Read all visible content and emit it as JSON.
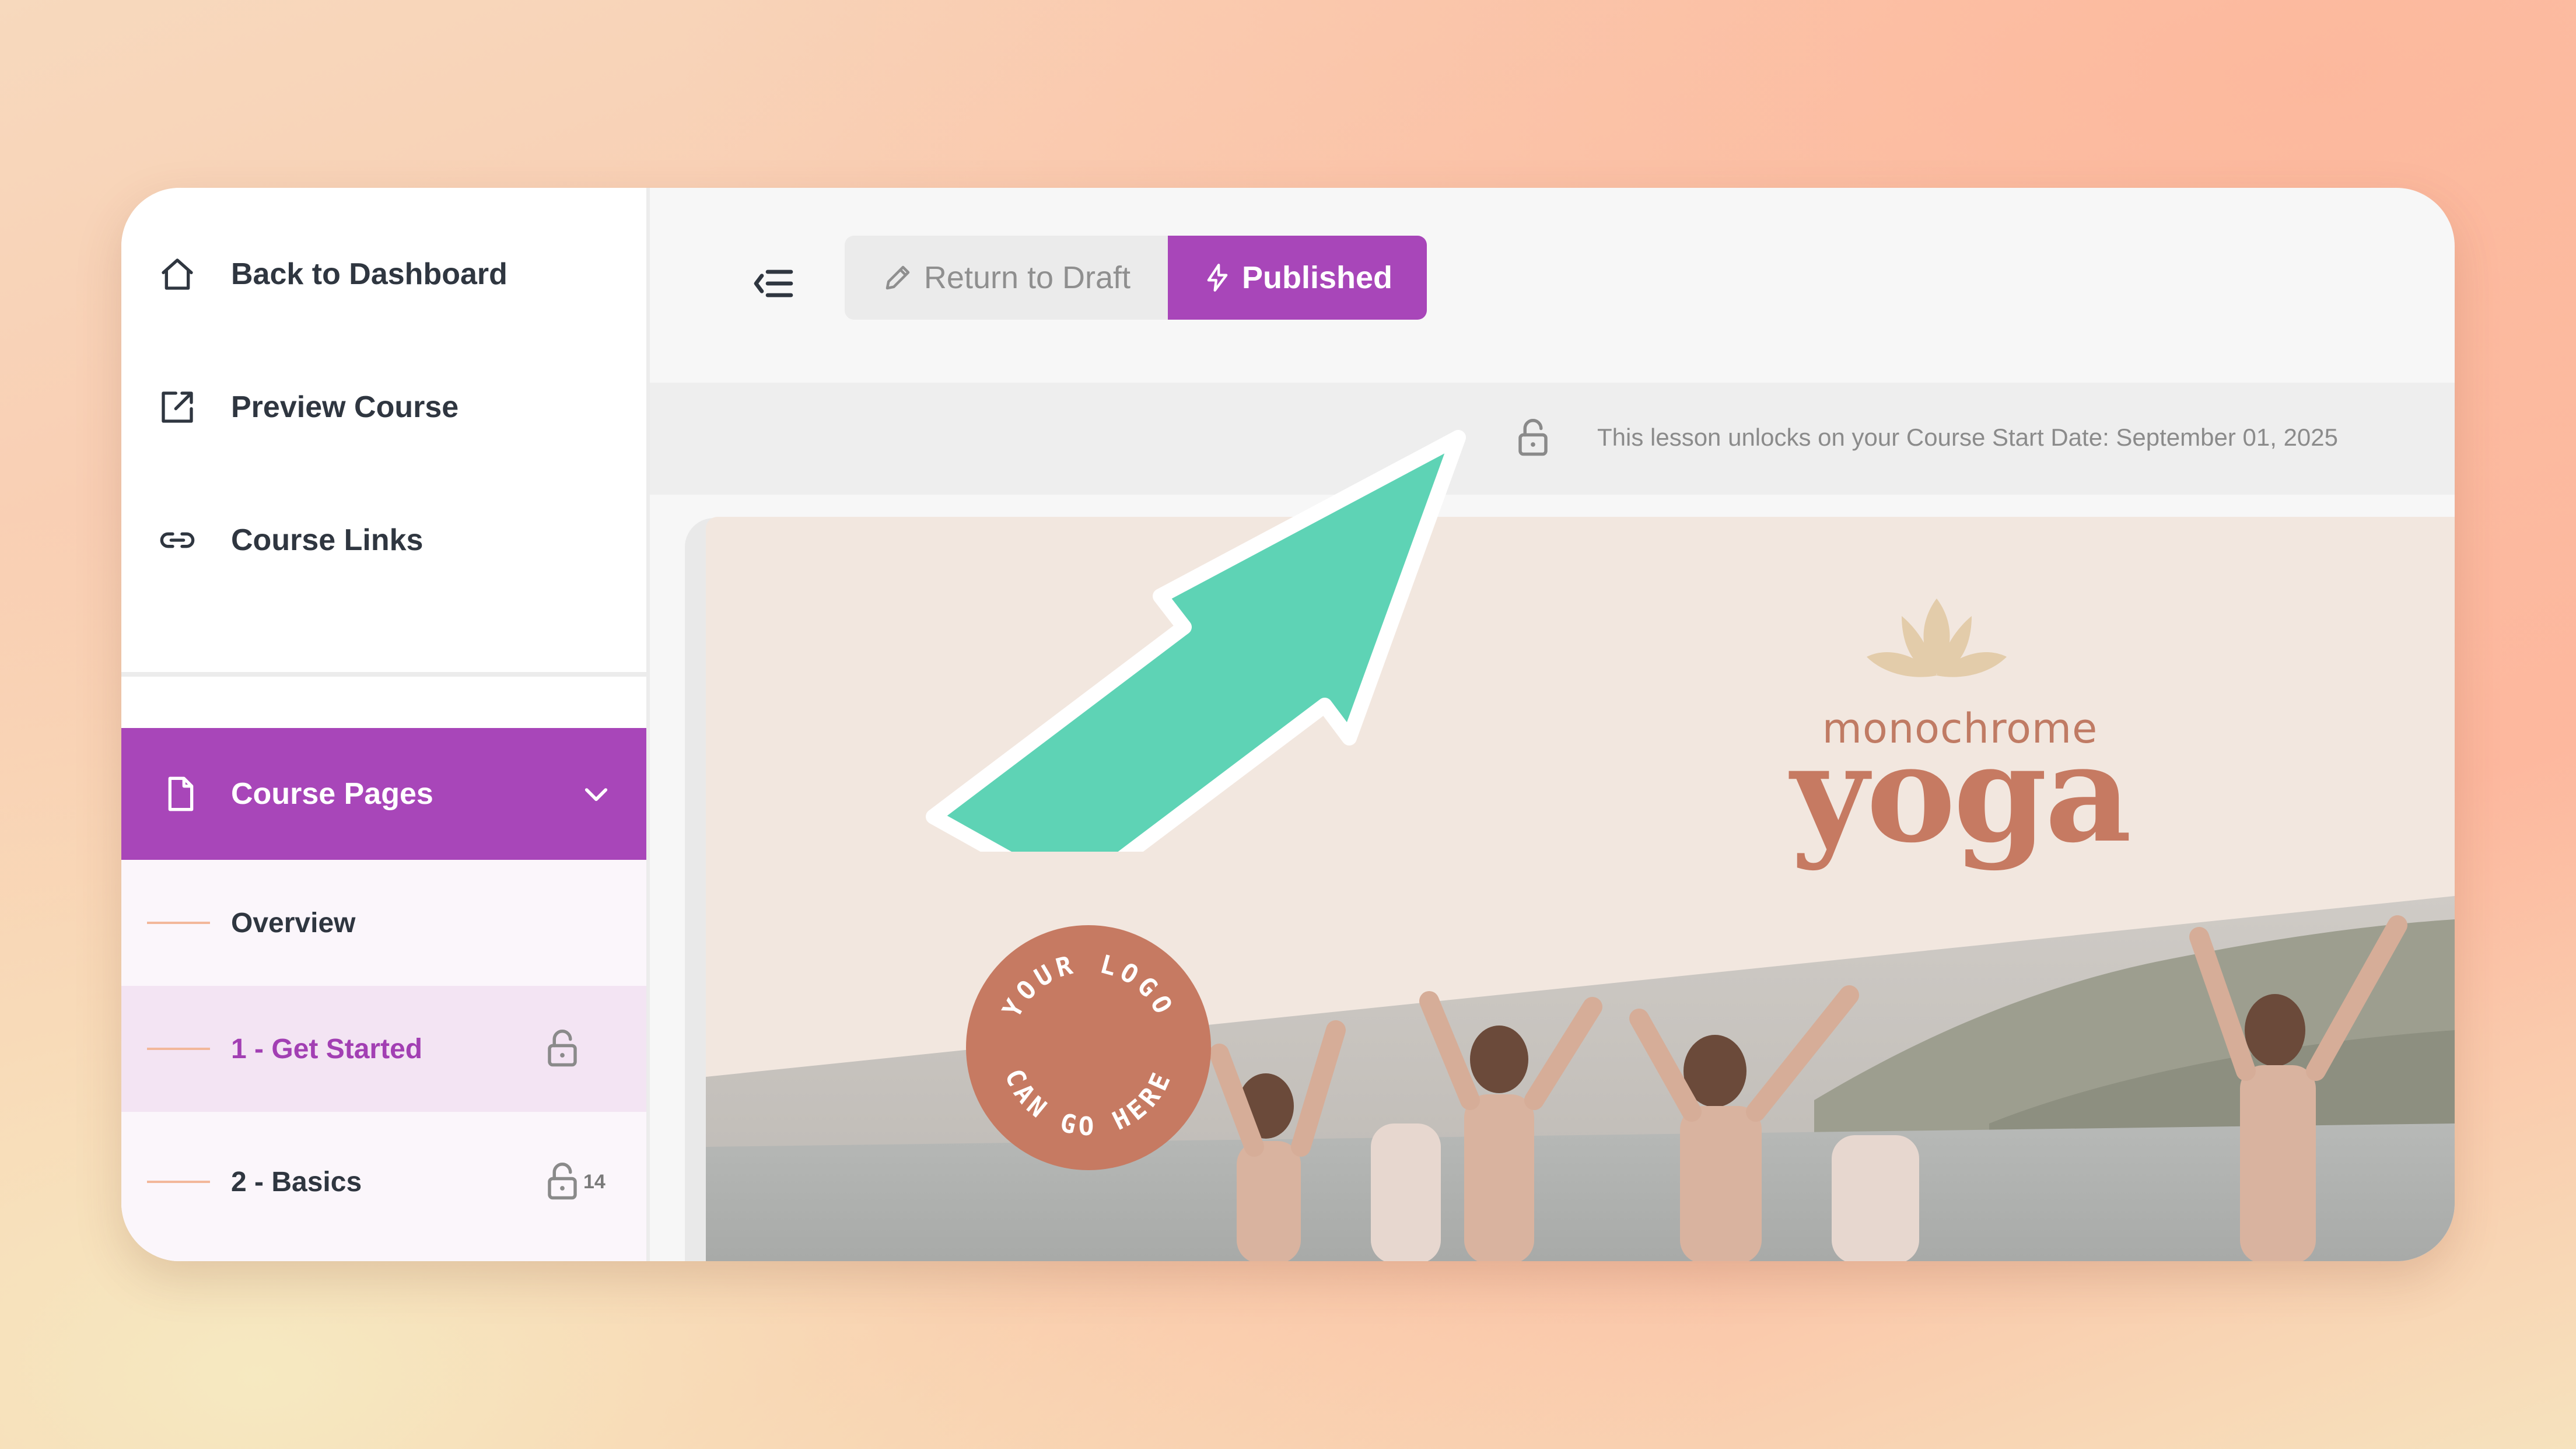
{
  "sidebar": {
    "nav": [
      {
        "label": "Back to Dashboard",
        "icon": "home-icon"
      },
      {
        "label": "Preview Course",
        "icon": "external-link-icon"
      },
      {
        "label": "Course Links",
        "icon": "link-icon"
      }
    ],
    "section": {
      "label": "Course Pages",
      "icon": "document-icon",
      "expanded": true
    },
    "pages": [
      {
        "label": "Overview"
      },
      {
        "label": "1 - Get Started",
        "active": true,
        "locked": true
      },
      {
        "label": "2 - Basics",
        "locked": true,
        "count": "14"
      }
    ]
  },
  "toolbar": {
    "menu_icon": "collapse-menu-icon",
    "draft_label": "Return to Draft",
    "published_label": "Published"
  },
  "notice": {
    "text": "This lesson unlocks on your Course Start Date: September 01, 2025"
  },
  "banner": {
    "brand_sub": "monochrome",
    "brand_main": "yoga",
    "logo_badge_text": "YOUR LOGO CAN GO HERE"
  },
  "colors": {
    "accent": "#a846b9",
    "arrow": "#5ed3b5",
    "brand": "#c67a62"
  }
}
